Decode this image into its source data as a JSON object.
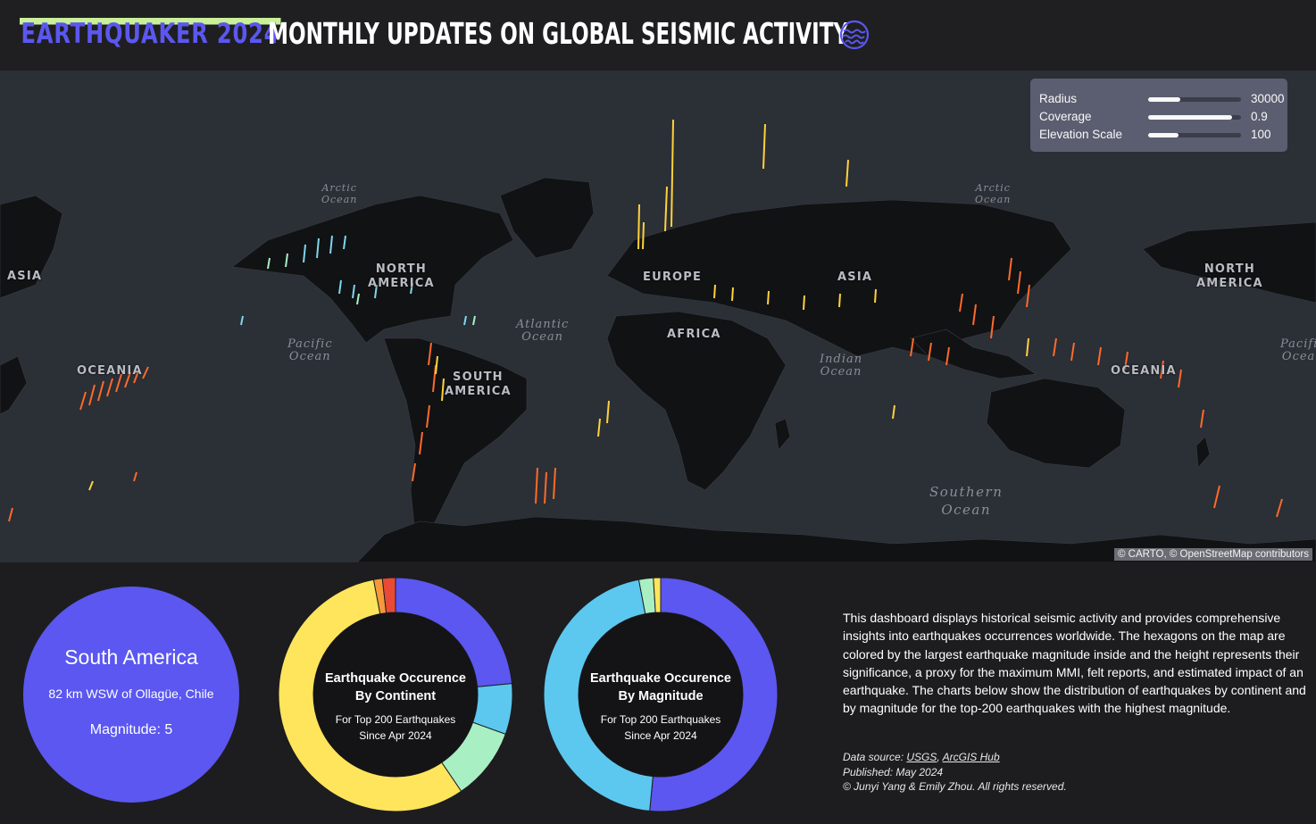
{
  "header": {
    "brand": "EARTHQUAKER 2024",
    "title": "MONTHLY UPDATES ON GLOBAL SEISMIC ACTIVITY",
    "icon": "wave-globe-icon",
    "brand_color": "#5b57f0",
    "brand_highlight": "#cbf09a"
  },
  "map": {
    "continent_labels": {
      "asia_left": "ASIA",
      "north_america": "NORTH\nAMERICA",
      "europe": "EUROPE",
      "asia": "ASIA",
      "north_america_right": "NORTH\nAMERICA",
      "oceania_left": "OCEANIA",
      "south_america": "SOUTH\nAMERICA",
      "africa": "AFRICA",
      "oceania": "OCEANIA"
    },
    "ocean_labels": {
      "arctic_left": "Arctic\nOcean",
      "arctic_right": "Arctic\nOcean",
      "pacific_left": "Pacific\nOcean",
      "atlantic": "Atlantic\nOcean",
      "indian": "Indian\nOcean",
      "pacific_right": "Pacific\nOcean",
      "southern": "Southern\nOcean"
    },
    "controls": {
      "radius": {
        "label": "Radius",
        "value": "30000",
        "level": 0.35
      },
      "coverage": {
        "label": "Coverage",
        "value": "0.9",
        "level": 0.9
      },
      "elevation": {
        "label": "Elevation Scale",
        "value": "100",
        "level": 0.33
      }
    },
    "attribution": "© CARTO, © OpenStreetMap contributors",
    "colors": {
      "water": "#2b2f36",
      "land": "#111214"
    }
  },
  "selected": {
    "continent": "South America",
    "place": "82 km WSW of Ollagüe, Chile",
    "magnitude_text": "Magnitude: 5"
  },
  "donut_continent": {
    "title_line1": "Earthquake Occurence",
    "title_line2": "By Continent",
    "sub_line1": "For Top 200 Earthquakes",
    "sub_line2": "Since Apr 2024",
    "segments": [
      {
        "value": 23.5,
        "color": "#5b57f0"
      },
      {
        "value": 7.0,
        "color": "#5cc8ef"
      },
      {
        "value": 10.0,
        "color": "#a8f0c4"
      },
      {
        "value": 56.5,
        "color": "#ffe55c"
      },
      {
        "value": 1.2,
        "color": "#f59a3a"
      },
      {
        "value": 1.8,
        "color": "#e84a36"
      }
    ]
  },
  "donut_magnitude": {
    "title_line1": "Earthquake Occurence",
    "title_line2": "By Magnitude",
    "sub_line1": "For Top 200 Earthquakes",
    "sub_line2": "Since Apr 2024",
    "segments": [
      {
        "value": 51.5,
        "color": "#5b57f0"
      },
      {
        "value": 45.5,
        "color": "#5cc8ef"
      },
      {
        "value": 2.0,
        "color": "#a8f0c4"
      },
      {
        "value": 1.0,
        "color": "#ffe55c"
      }
    ]
  },
  "description": "This dashboard displays historical seismic activity and provides comprehensive insights into earthquakes occurrences worldwide. The hexagons on the map are colored by the largest earthquake magnitude inside and the height represents their significance, a proxy for the maximum MMI, felt reports, and estimated impact of an earthquake. The charts below show the distribution of earthquakes by continent and by magnitude for the top-200 earthquakes with the highest magnitude.",
  "credits": {
    "source_prefix": "Data source: ",
    "source_link1": "USGS",
    "source_sep": ", ",
    "source_link2": "ArcGIS Hub",
    "published": "Published: May 2024",
    "copyright": "© Junyi Yang & Emily Zhou. All rights reserved."
  }
}
